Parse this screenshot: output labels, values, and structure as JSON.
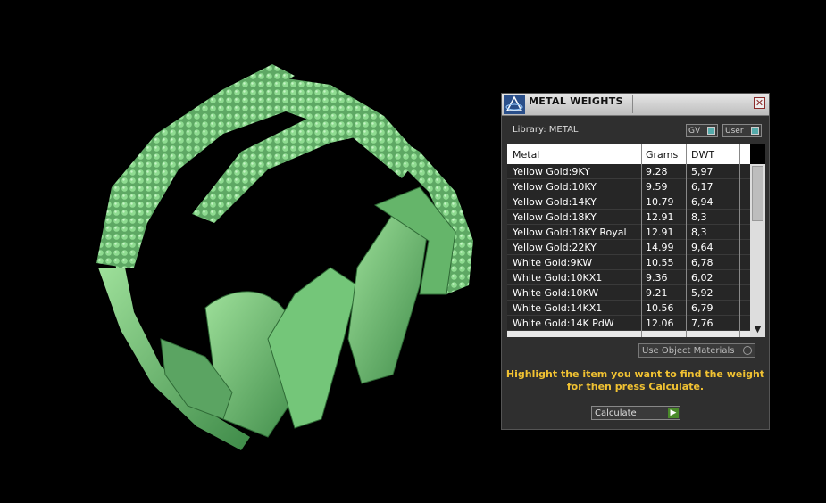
{
  "panel": {
    "title": "METAL WEIGHTS",
    "library_label": "Library: METAL",
    "toggles": {
      "gv": "GV",
      "user": "User"
    },
    "columns": [
      "Metal",
      "Grams",
      "DWT"
    ],
    "rows": [
      [
        "Yellow Gold:9KY",
        "9.28",
        "5,97"
      ],
      [
        "Yellow Gold:10KY",
        "9.59",
        "6,17"
      ],
      [
        "Yellow Gold:14KY",
        "10.79",
        "6,94"
      ],
      [
        "Yellow Gold:18KY",
        "12.91",
        "8,3"
      ],
      [
        "Yellow Gold:18KY Royal",
        "12.91",
        "8,3"
      ],
      [
        "Yellow Gold:22KY",
        "14.99",
        "9,64"
      ],
      [
        "White Gold:9KW",
        "10.55",
        "6,78"
      ],
      [
        "White Gold:10KX1",
        "9.36",
        "6,02"
      ],
      [
        "White Gold:10KW",
        "9.21",
        "5,92"
      ],
      [
        "White Gold:14KX1",
        "10.56",
        "6,79"
      ],
      [
        "White Gold:14K PdW",
        "12.06",
        "7,76"
      ]
    ],
    "use_materials_label": "Use Object Materials",
    "hint": "Highlight the item you want to find the weight for then press Calculate.",
    "calculate_label": "Calculate"
  },
  "colors": {
    "model": "#6fbf73",
    "hint": "#f1c232",
    "accent": "#4a8a2a"
  }
}
